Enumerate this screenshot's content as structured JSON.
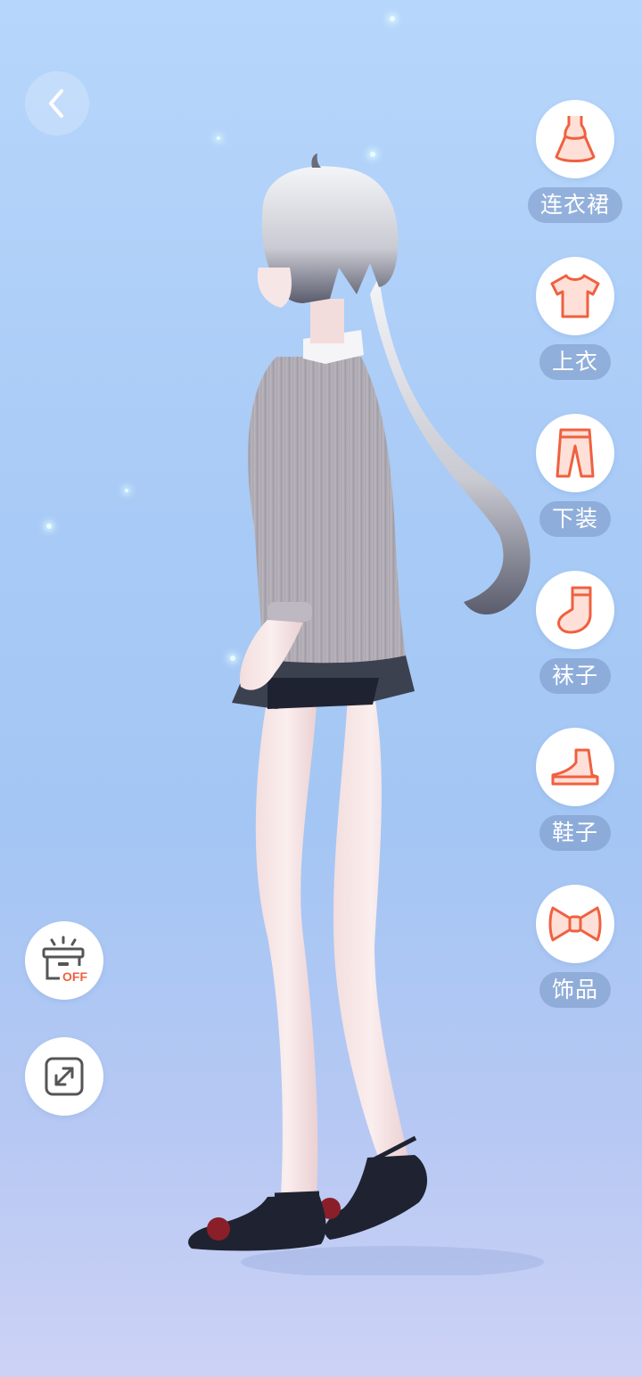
{
  "navigation": {
    "back_icon": "chevron-left-icon"
  },
  "categories": [
    {
      "label": "连衣裙",
      "icon": "dress-icon"
    },
    {
      "label": "上衣",
      "icon": "tshirt-icon"
    },
    {
      "label": "下装",
      "icon": "pants-icon"
    },
    {
      "label": "袜子",
      "icon": "sock-icon"
    },
    {
      "label": "鞋子",
      "icon": "shoe-icon"
    },
    {
      "label": "饰品",
      "icon": "bow-icon"
    }
  ],
  "tools": {
    "hide_wardrobe_badge": "OFF",
    "hide_wardrobe_icon": "wardrobe-off-icon",
    "fullscreen_icon": "fullscreen-icon"
  },
  "colors": {
    "accent": "#f0603f",
    "label_bg": "#8aa3c9",
    "background_top": "#b7d6fb",
    "background_bottom": "#cdd2f5"
  }
}
